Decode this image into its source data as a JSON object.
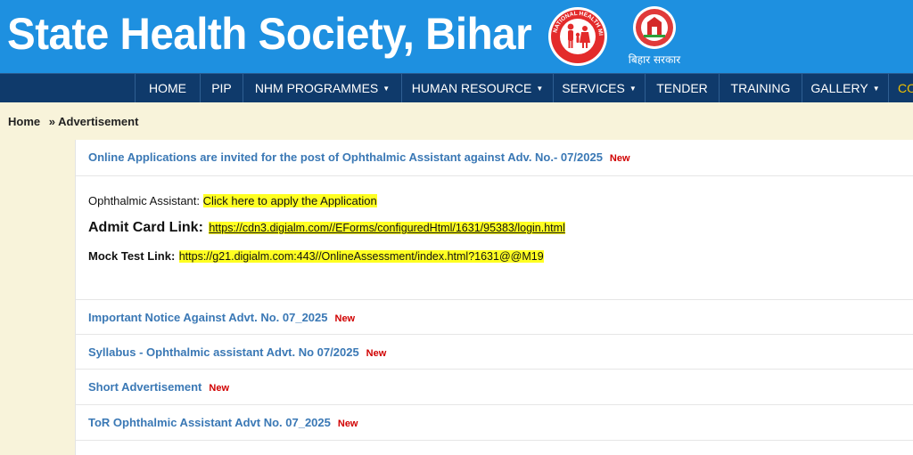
{
  "header": {
    "title": "State Health Society, Bihar",
    "nhm_logo_text": "NATIONAL HEALTH MISSION",
    "bihar_logo_caption": "बिहार सरकार"
  },
  "nav": {
    "items": [
      {
        "label": "HOME",
        "caret": ""
      },
      {
        "label": "PIP",
        "caret": ""
      },
      {
        "label": "NHM PROGRAMMES",
        "caret": "▼"
      },
      {
        "label": "HUMAN RESOURCE",
        "caret": "▼"
      },
      {
        "label": "SERVICES",
        "caret": "▼"
      },
      {
        "label": "TENDER",
        "caret": ""
      },
      {
        "label": "TRAINING",
        "caret": ""
      },
      {
        "label": "GALLERY",
        "caret": "▼"
      },
      {
        "label": "CO",
        "caret": ""
      }
    ]
  },
  "breadcrumb": {
    "home": "Home",
    "separator": "»",
    "current": "Advertisement"
  },
  "main": {
    "headline": "Online Applications are invited for the post of Ophthalmic Assistant against Adv. No.- 07/2025",
    "new_label": "New",
    "apply_prefix": "Ophthalmic Assistant:",
    "apply_link": "Click here to apply the Application",
    "admit_label": "Admit Card Link:",
    "admit_url": "https://cdn3.digialm.com//EForms/configuredHtml/1631/95383/login.html",
    "mock_label": "Mock Test Link:",
    "mock_url": "https://g21.digialm.com:443//OnlineAssessment/index.html?1631@@M19",
    "links": [
      {
        "label": "Important Notice Against Advt. No. 07_2025",
        "badge": "New"
      },
      {
        "label": "Syllabus - Ophthalmic assistant Advt. No 07/2025",
        "badge": "New"
      },
      {
        "label": "Short Advertisement",
        "badge": "New"
      },
      {
        "label": "ToR Ophthalmic Assistant Advt No. 07_2025",
        "badge": "New"
      }
    ]
  },
  "colors": {
    "header_bg": "#1e90e0",
    "nav_bg": "#0f3a6b",
    "page_bg": "#f8f3da",
    "link": "#3a78b5",
    "new_badge": "#d10000",
    "highlight": "#ffff22"
  }
}
